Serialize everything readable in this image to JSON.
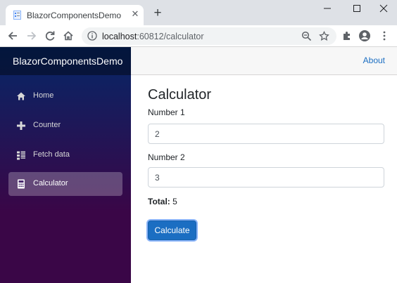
{
  "browser": {
    "tab_title": "BlazorComponentsDemo",
    "url_host": "localhost",
    "url_path": ":60812/calculator"
  },
  "sidebar": {
    "brand": "BlazorComponentsDemo",
    "items": [
      {
        "label": "Home",
        "icon": "home-icon"
      },
      {
        "label": "Counter",
        "icon": "plus-icon"
      },
      {
        "label": "Fetch data",
        "icon": "list-icon"
      },
      {
        "label": "Calculator",
        "icon": "calculator-icon",
        "active": true
      }
    ]
  },
  "top_row": {
    "about_link": "About"
  },
  "main": {
    "title": "Calculator",
    "number1_label": "Number 1",
    "number1_value": "2",
    "number2_label": "Number 2",
    "number2_value": "3",
    "total_label": "Total:",
    "total_value": "5",
    "calculate_button": "Calculate"
  },
  "colors": {
    "accent": "#1b6ec2",
    "sidebar_top": "#052767",
    "sidebar_bottom": "#3a0647"
  }
}
